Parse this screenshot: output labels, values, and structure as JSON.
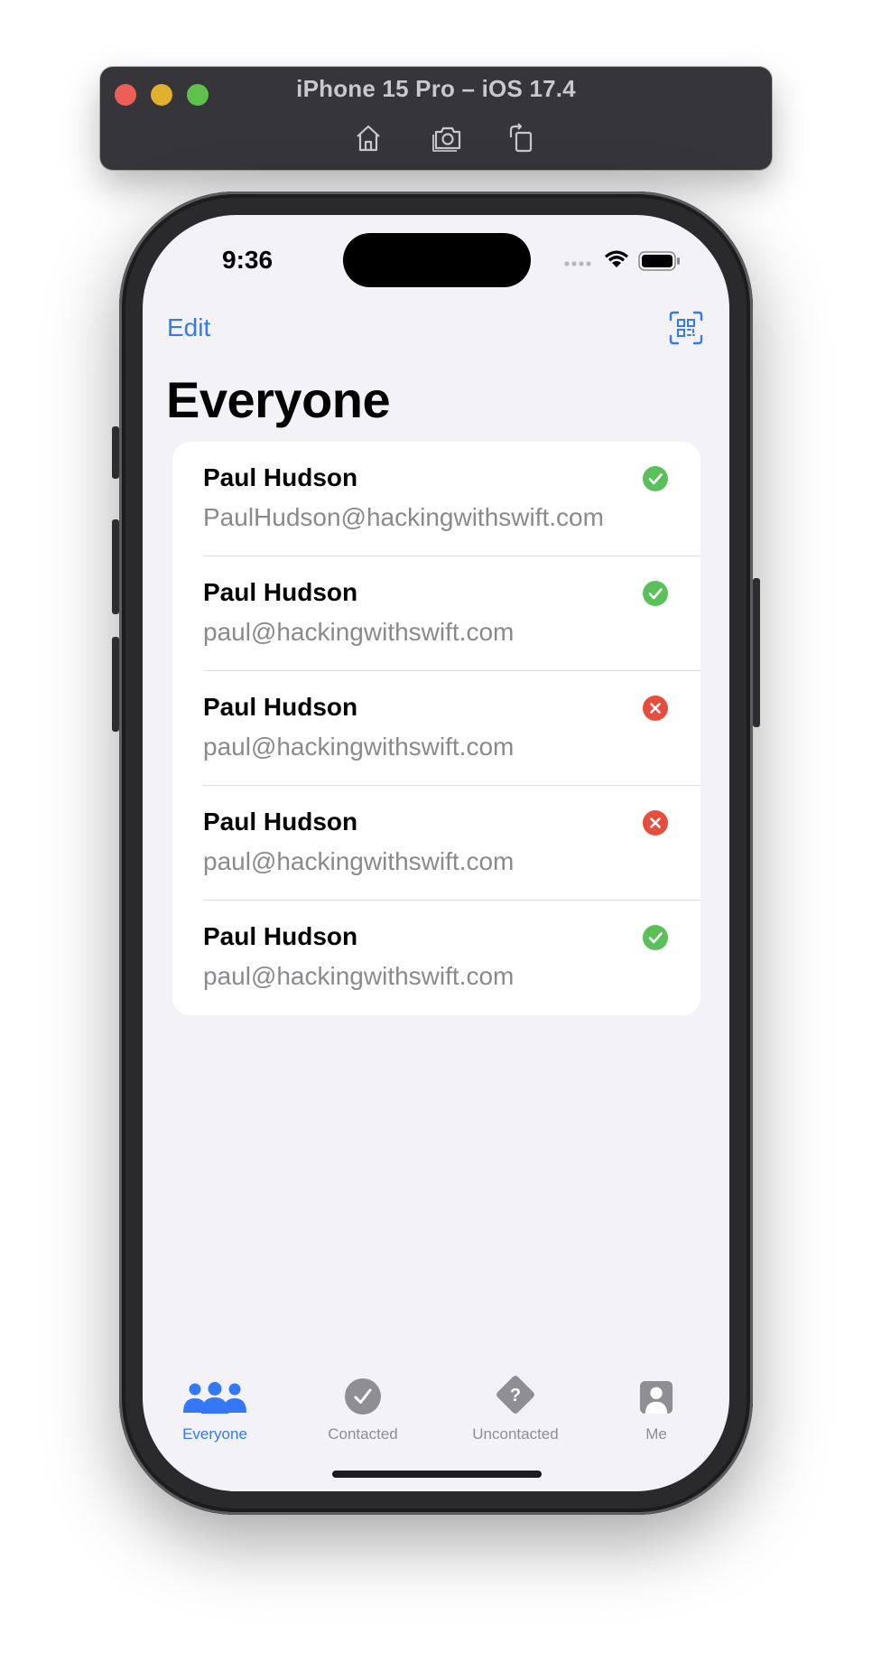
{
  "window": {
    "title": "iPhone 15 Pro – iOS 17.4",
    "toolbar": [
      "home-icon",
      "screenshot-icon",
      "rotate-icon"
    ]
  },
  "status_bar": {
    "time": "9:36"
  },
  "nav": {
    "edit_label": "Edit",
    "scan_icon": "qr-code-scan-icon"
  },
  "page": {
    "title": "Everyone"
  },
  "contacts": [
    {
      "name": "Paul Hudson",
      "email": "PaulHudson@hackingwithswift.com",
      "status": "contacted"
    },
    {
      "name": "Paul Hudson",
      "email": "paul@hackingwithswift.com",
      "status": "contacted"
    },
    {
      "name": "Paul Hudson",
      "email": "paul@hackingwithswift.com",
      "status": "uncontacted"
    },
    {
      "name": "Paul Hudson",
      "email": "paul@hackingwithswift.com",
      "status": "uncontacted"
    },
    {
      "name": "Paul Hudson",
      "email": "paul@hackingwithswift.com",
      "status": "contacted"
    }
  ],
  "tabs": [
    {
      "label": "Everyone",
      "icon": "people-icon",
      "active": true
    },
    {
      "label": "Contacted",
      "icon": "checkmark-circle-icon",
      "active": false
    },
    {
      "label": "Uncontacted",
      "icon": "questionmark-diamond-icon",
      "active": false
    },
    {
      "label": "Me",
      "icon": "person-square-icon",
      "active": false
    }
  ],
  "colors": {
    "accent": "#3478f6",
    "contacted": "#5ac05a",
    "uncontacted": "#e54d3c",
    "background": "#f2f2f7",
    "inactive_tab": "#8e8e93"
  }
}
